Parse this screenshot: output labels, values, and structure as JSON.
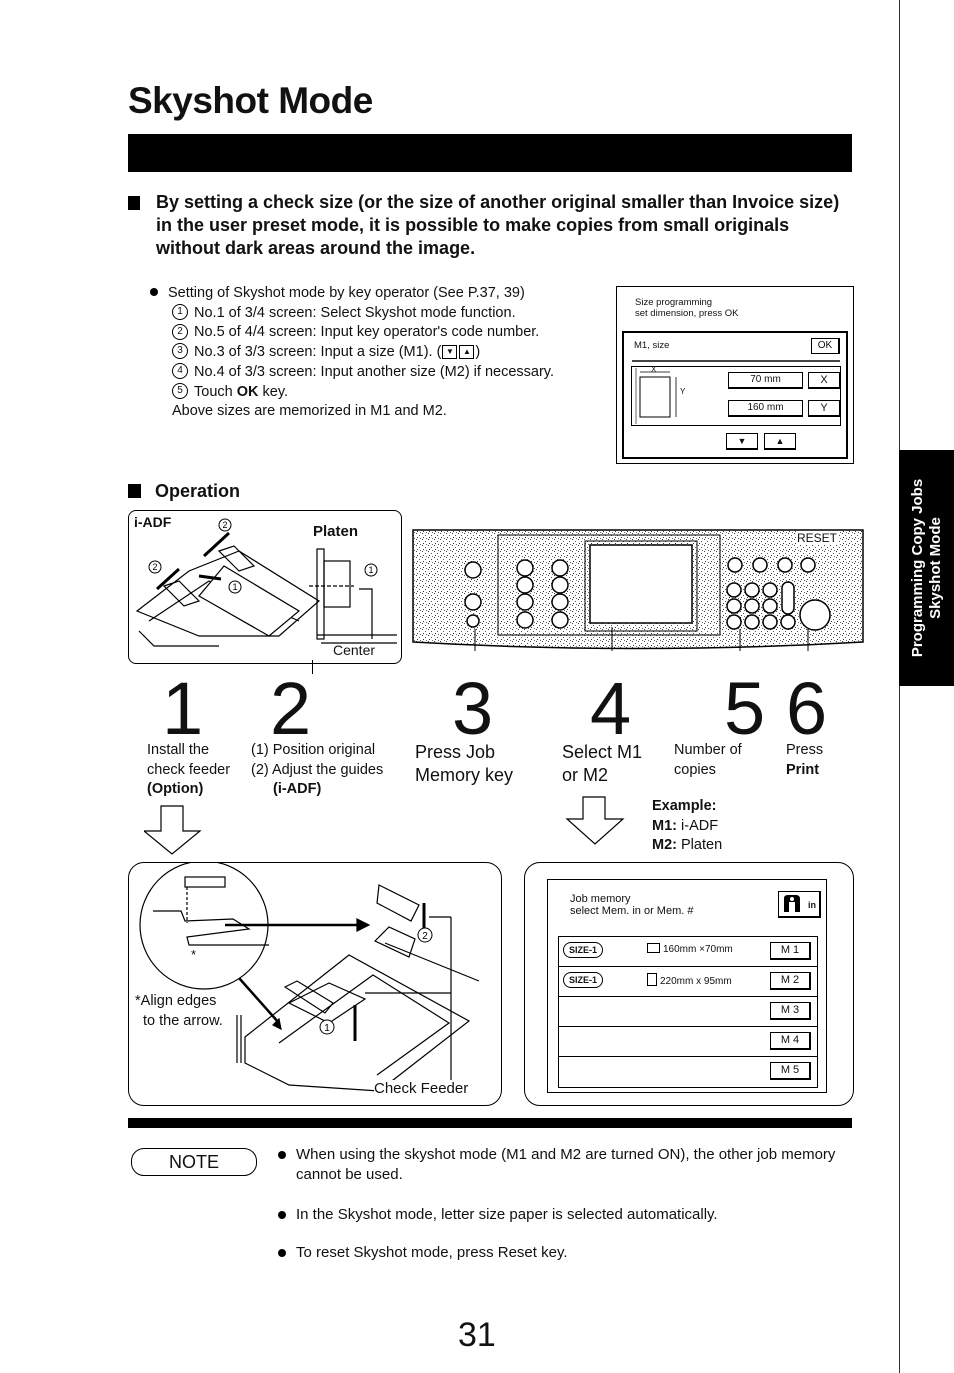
{
  "page": {
    "title": "Skyshot Mode",
    "intro": "By setting a check size (or the size of another original smaller than Invoice size) in the user preset mode, it is possible to make copies from small originals without dark areas around the image.",
    "page_number": "31",
    "side_tab": {
      "line1": "Programming Copy Jobs",
      "line2": "Skyshot Mode"
    }
  },
  "setting": {
    "heading": "Setting of Skyshot mode by key operator (See P.37, 39)",
    "steps": [
      {
        "num": "1",
        "text": "No.1 of 3/4 screen: Select Skyshot mode function."
      },
      {
        "num": "2",
        "text": "No.5 of 4/4 screen: Input key operator's code number."
      },
      {
        "num": "3",
        "text": "No.3 of 3/3 screen: Input a size (M1).",
        "keys": [
          "▼",
          "▲"
        ]
      },
      {
        "num": "4",
        "text": "No.4 of 3/3 screen: Input another size (M2) if necessary."
      },
      {
        "num": "5",
        "text_pre": "Touch ",
        "text_bold": "OK",
        "text_post": " key."
      }
    ],
    "note": "Above sizes are memorized in M1 and M2."
  },
  "size_screen": {
    "title_line1": "Size programming",
    "title_line2": "set dimension, press OK",
    "field_label": "M1, size",
    "ok_label": "OK",
    "x_value": "70 mm",
    "y_value": "160 mm",
    "x_button": "X",
    "y_button": "Y",
    "x_axis": "X",
    "y_axis": "Y",
    "down_icon": "▼",
    "up_icon": "▲"
  },
  "operation": {
    "heading": "Operation",
    "adf_label": "i-ADF",
    "platen_label": "Platen",
    "center_label": "Center",
    "callout_1": "1",
    "callout_2": "2",
    "panel_reset_label": "RESET",
    "steps": [
      {
        "num": "1",
        "lines": [
          "Install the",
          "check feeder"
        ],
        "bold": "(Option)"
      },
      {
        "num": "2",
        "lines": [
          "(1) Position original",
          "(2) Adjust the guides"
        ],
        "bold": "(i-ADF)"
      },
      {
        "num": "3",
        "lines": [
          "Press Job",
          "Memory key"
        ]
      },
      {
        "num": "4",
        "lines": [
          "Select M1",
          "or M2"
        ]
      },
      {
        "num": "5",
        "lines": [
          "Number of",
          "copies"
        ]
      },
      {
        "num": "6",
        "lines": [
          "Press"
        ],
        "bold": "Print"
      }
    ],
    "example": {
      "heading": "Example:",
      "m1_label": "M1:",
      "m1_value": " i-ADF",
      "m2_label": "M2:",
      "m2_value": " Platen"
    },
    "feeder": {
      "align_note_line1": "*Align edges",
      "align_note_line2": "to the arrow.",
      "asterisk": "*",
      "label": "Check Feeder"
    }
  },
  "job_memory": {
    "title_line1": "Job memory",
    "title_line2": "select Mem. in or Mem. #",
    "icon_label": "in",
    "rows": [
      {
        "size_badge": "SIZE-1",
        "dimension": "160mm ×70mm",
        "button": "M 1"
      },
      {
        "size_badge": "SIZE-1",
        "dimension": "220mm x 95mm",
        "button": "M 2"
      },
      {
        "size_badge": "",
        "dimension": "",
        "button": "M 3"
      },
      {
        "size_badge": "",
        "dimension": "",
        "button": "M 4"
      },
      {
        "size_badge": "",
        "dimension": "",
        "button": "M 5"
      }
    ]
  },
  "notes": {
    "badge": "NOTE",
    "items": [
      "When using the skyshot mode (M1 and M2 are turned ON), the other job memory cannot be used.",
      "In the Skyshot mode, letter size paper is selected automatically.",
      "To reset Skyshot mode, press Reset key."
    ]
  }
}
